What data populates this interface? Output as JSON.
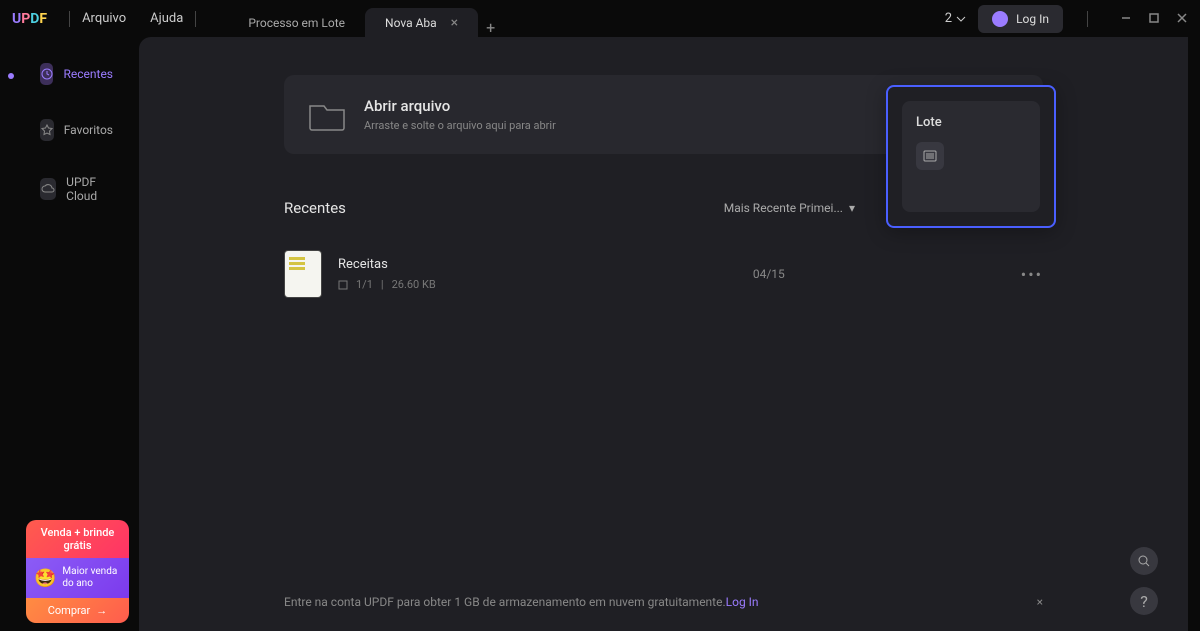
{
  "logo": "UPDF",
  "menu": {
    "file": "Arquivo",
    "help": "Ajuda"
  },
  "tabs": {
    "batch": "Processo em Lote",
    "new": "Nova Aba"
  },
  "header": {
    "counter": "2",
    "login": "Log In"
  },
  "sidebar": {
    "recent": "Recentes",
    "favorites": "Favoritos",
    "cloud": "UPDF Cloud"
  },
  "open_card": {
    "title": "Abrir arquivo",
    "subtitle": "Arraste e solte o arquivo aqui para abrir"
  },
  "lote": {
    "title": "Lote"
  },
  "recent": {
    "title": "Recentes",
    "sort": "Mais Recente Primei...",
    "files": [
      {
        "name": "Receitas",
        "pages": "1/1",
        "size": "26.60 KB",
        "date": "04/15"
      }
    ]
  },
  "promo": {
    "top": "Venda + brinde grátis",
    "mid": "Maior venda do ano",
    "btn": "Comprar"
  },
  "banner": {
    "text": "Entre na conta UPDF para obter 1 GB de armazenamento em nuvem gratuitamente.",
    "link": "Log In"
  }
}
